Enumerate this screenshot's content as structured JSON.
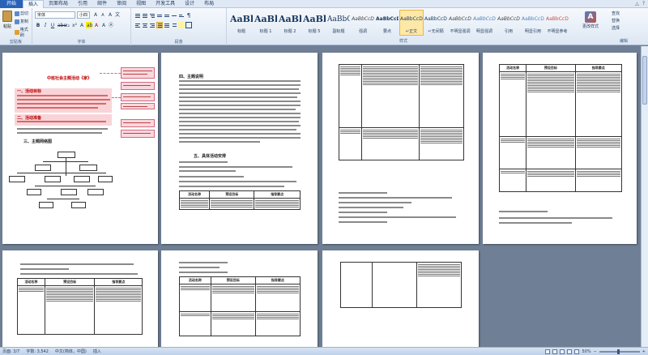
{
  "menu": {
    "file": "开始",
    "tabs": [
      "插入",
      "页面布局",
      "引用",
      "邮件",
      "审阅",
      "视图",
      "开发工具",
      "设计",
      "布局"
    ]
  },
  "ribbon": {
    "clipboard": {
      "paste": "粘贴",
      "cut": "剪切",
      "copy": "复制",
      "format_painter": "格式刷",
      "label": "剪贴板"
    },
    "font": {
      "font_name": "宋体",
      "font_size": "小四",
      "label": "字体"
    },
    "paragraph": {
      "label": "段落"
    },
    "styles": {
      "label": "样式",
      "items": [
        {
          "sample": "AaBbC",
          "name": "标题"
        },
        {
          "sample": "AaBb",
          "name": "标题 1"
        },
        {
          "sample": "AaBbC",
          "name": "标题 2"
        },
        {
          "sample": "AaBbCc",
          "name": "标题 5"
        },
        {
          "sample": "AaBbC",
          "name": "副标题"
        },
        {
          "sample": "AaBbCcD",
          "name": "强调"
        },
        {
          "sample": "AaBbCcD",
          "name": "要点"
        },
        {
          "sample": "AaBbCcDd",
          "name": "↵正文"
        },
        {
          "sample": "AaBbCcDd",
          "name": "↵无间隔"
        },
        {
          "sample": "AaBbCcDd",
          "name": "不明显强调"
        },
        {
          "sample": "AaBbCcDd",
          "name": "明显强调"
        },
        {
          "sample": "AaBbCcDd",
          "name": "引用"
        },
        {
          "sample": "AaBbCcDd",
          "name": "明显引用"
        },
        {
          "sample": "AaBbCcDd",
          "name": "不明显参考"
        }
      ]
    },
    "change_styles": "更改样式",
    "editing": {
      "find": "查找",
      "replace": "替换",
      "select": "选择",
      "label": "编辑"
    }
  },
  "status": {
    "page": "页面: 3/7",
    "words": "字数: 3,542",
    "language": "中文(简体，中国)",
    "mode": "插入",
    "zoom": "50%"
  },
  "document": {
    "page1_title": "中班社会主题活动《家》",
    "page1_h1": "一、活动目标",
    "page1_h2": "二、活动准备",
    "page1_h3": "三、主题网络图",
    "page2_h1": "四、主题说明",
    "page2_h2": "五、具体活动安排",
    "table_headers": [
      "活动名称",
      "预设目标",
      "指导要点"
    ]
  }
}
